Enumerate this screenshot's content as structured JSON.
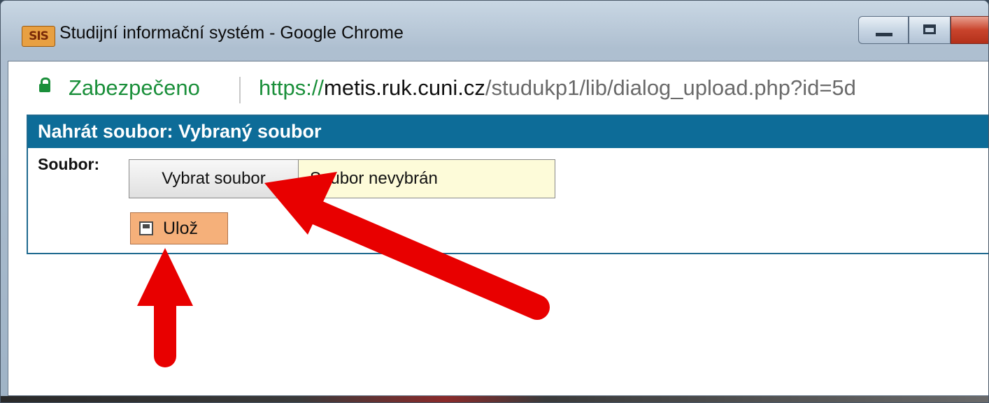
{
  "window": {
    "app_icon_text": "SIS",
    "title": "Studijní informační systém - Google Chrome"
  },
  "addressbar": {
    "secure_label": "Zabezpečeno",
    "url_scheme": "https://",
    "url_host": "metis.ruk.cuni.cz",
    "url_path": "/studukp1/lib/dialog_upload.php?id=5d"
  },
  "dialog": {
    "header": "Nahrát soubor: Vybraný soubor",
    "field_label": "Soubor:",
    "choose_button_label": "Vybrat soubor",
    "file_status": "Soubor nevybrán",
    "save_button_label": "Ulož"
  },
  "colors": {
    "annotation_arrow": "#e80000",
    "header_bg": "#0d6c98",
    "save_button_bg": "#f5b07a",
    "file_field_bg": "#fdfbd9",
    "secure_green": "#1a8f3a"
  }
}
